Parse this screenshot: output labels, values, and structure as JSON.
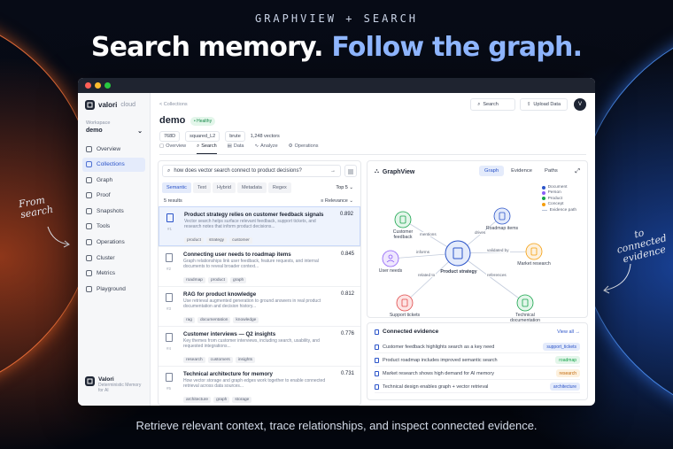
{
  "hero": {
    "eyebrow": "GRAPHVIEW + SEARCH",
    "headline_a": "Search memory.",
    "headline_b": "Follow the graph.",
    "tagline": "Retrieve relevant context, trace relationships, and inspect connected evidence.",
    "note_left_1": "From",
    "note_left_2": "search",
    "note_right_1": "to",
    "note_right_2": "connected",
    "note_right_3": "evidence"
  },
  "sidebar": {
    "brand": "valori",
    "brand_suffix": "cloud",
    "workspace_label": "Workspace",
    "workspace_value": "demo",
    "items": [
      {
        "label": "Overview",
        "icon": "home-icon"
      },
      {
        "label": "Collections",
        "icon": "layers-icon"
      },
      {
        "label": "Graph",
        "icon": "graph-icon"
      },
      {
        "label": "Proof",
        "icon": "shield-icon"
      },
      {
        "label": "Snapshots",
        "icon": "camera-icon"
      },
      {
        "label": "Tools",
        "icon": "wrench-icon"
      },
      {
        "label": "Operations",
        "icon": "gear-icon"
      },
      {
        "label": "Cluster",
        "icon": "server-icon"
      },
      {
        "label": "Metrics",
        "icon": "chart-icon"
      },
      {
        "label": "Playground",
        "icon": "terminal-icon"
      }
    ],
    "active": "Collections",
    "footer_title": "Valori",
    "footer_sub": "Deterministic Memory for AI"
  },
  "header": {
    "breadcrumb": "< Collections",
    "title": "demo",
    "status": "• Healthy",
    "dims": "768D",
    "metric": "squared_L2",
    "index": "brute",
    "vectors": "1,248 vectors",
    "search_label": "Search",
    "upload_label": "Upload Data",
    "avatar": "V"
  },
  "tabs": [
    "Overview",
    "Search",
    "Data",
    "Analyze",
    "Operations"
  ],
  "active_tab": "Search",
  "search": {
    "query": "how does vector search connect to product decisions?",
    "modes": [
      "Semantic",
      "Text",
      "Hybrid",
      "Metadata",
      "Regex"
    ],
    "active_mode": "Semantic",
    "topk": "Top 5 ⌄",
    "count": "5 results",
    "sort": "≡ Relevance ⌄"
  },
  "results": [
    {
      "num": "#1",
      "title": "Product strategy relies on customer feedback signals",
      "score": "0.892",
      "desc": "Vector search helps surface relevant feedback, support tickets, and research notes that inform product decisions...",
      "tags": [
        "product",
        "strategy",
        "customer"
      ]
    },
    {
      "num": "#2",
      "title": "Connecting user needs to roadmap items",
      "score": "0.845",
      "desc": "Graph relationships link user feedback, feature requests, and internal documents to reveal broader context...",
      "tags": [
        "roadmap",
        "product",
        "graph"
      ]
    },
    {
      "num": "#3",
      "title": "RAG for product knowledge",
      "score": "0.812",
      "desc": "Use retrieval augmented generation to ground answers in real product documentation and decision history...",
      "tags": [
        "rag",
        "documentation",
        "knowledge"
      ]
    },
    {
      "num": "#4",
      "title": "Customer interviews — Q2 insights",
      "score": "0.776",
      "desc": "Key themes from customer interviews, including search, usability, and requested integrations...",
      "tags": [
        "research",
        "customers",
        "insights"
      ]
    },
    {
      "num": "#5",
      "title": "Technical architecture for memory",
      "score": "0.731",
      "desc": "How vector storage and graph edges work together to enable connected retrieval across data sources...",
      "tags": [
        "architecture",
        "graph",
        "storage"
      ]
    }
  ],
  "graph": {
    "title": "GraphView",
    "tabs": [
      "Graph",
      "Evidence",
      "Paths"
    ],
    "active_tab": "Graph",
    "legend": [
      {
        "label": "Document",
        "color": "#2b54c9"
      },
      {
        "label": "Person",
        "color": "#8b5cf6"
      },
      {
        "label": "Product",
        "color": "#16a34a"
      },
      {
        "label": "Concept",
        "color": "#f59e0b"
      },
      {
        "label": "Evidence path",
        "color": "#b8c2d6"
      }
    ],
    "nodes": {
      "center": "Product strategy",
      "feedback": "Customer feedback",
      "roadmap": "Roadmap items",
      "user": "User needs",
      "research": "Market research",
      "tickets": "Support tickets",
      "techdoc": "Technical documentation"
    },
    "edges": {
      "mentions": "mentions",
      "drives": "drives",
      "informs": "informs",
      "validated": "validated by",
      "related": "related to",
      "references": "references"
    }
  },
  "evidence": {
    "title": "Connected evidence",
    "view_all": "View all →",
    "rows": [
      {
        "text": "Customer feedback highlights search as a key need",
        "badge": "support_tickets",
        "color": "#2b54c9",
        "bg": "#e4ebfb"
      },
      {
        "text": "Product roadmap includes improved semantic search",
        "badge": "roadmap",
        "color": "#16a34a",
        "bg": "#e3f6ea"
      },
      {
        "text": "Market research shows high demand for AI memory",
        "badge": "research",
        "color": "#c2690b",
        "bg": "#fdf1de"
      },
      {
        "text": "Technical design enables graph + vector retrieval",
        "badge": "architecture",
        "color": "#2b54c9",
        "bg": "#e4ebfb"
      }
    ]
  },
  "colors": {
    "accent": "#2b54c9",
    "headline_accent": "#8fb6ff"
  }
}
